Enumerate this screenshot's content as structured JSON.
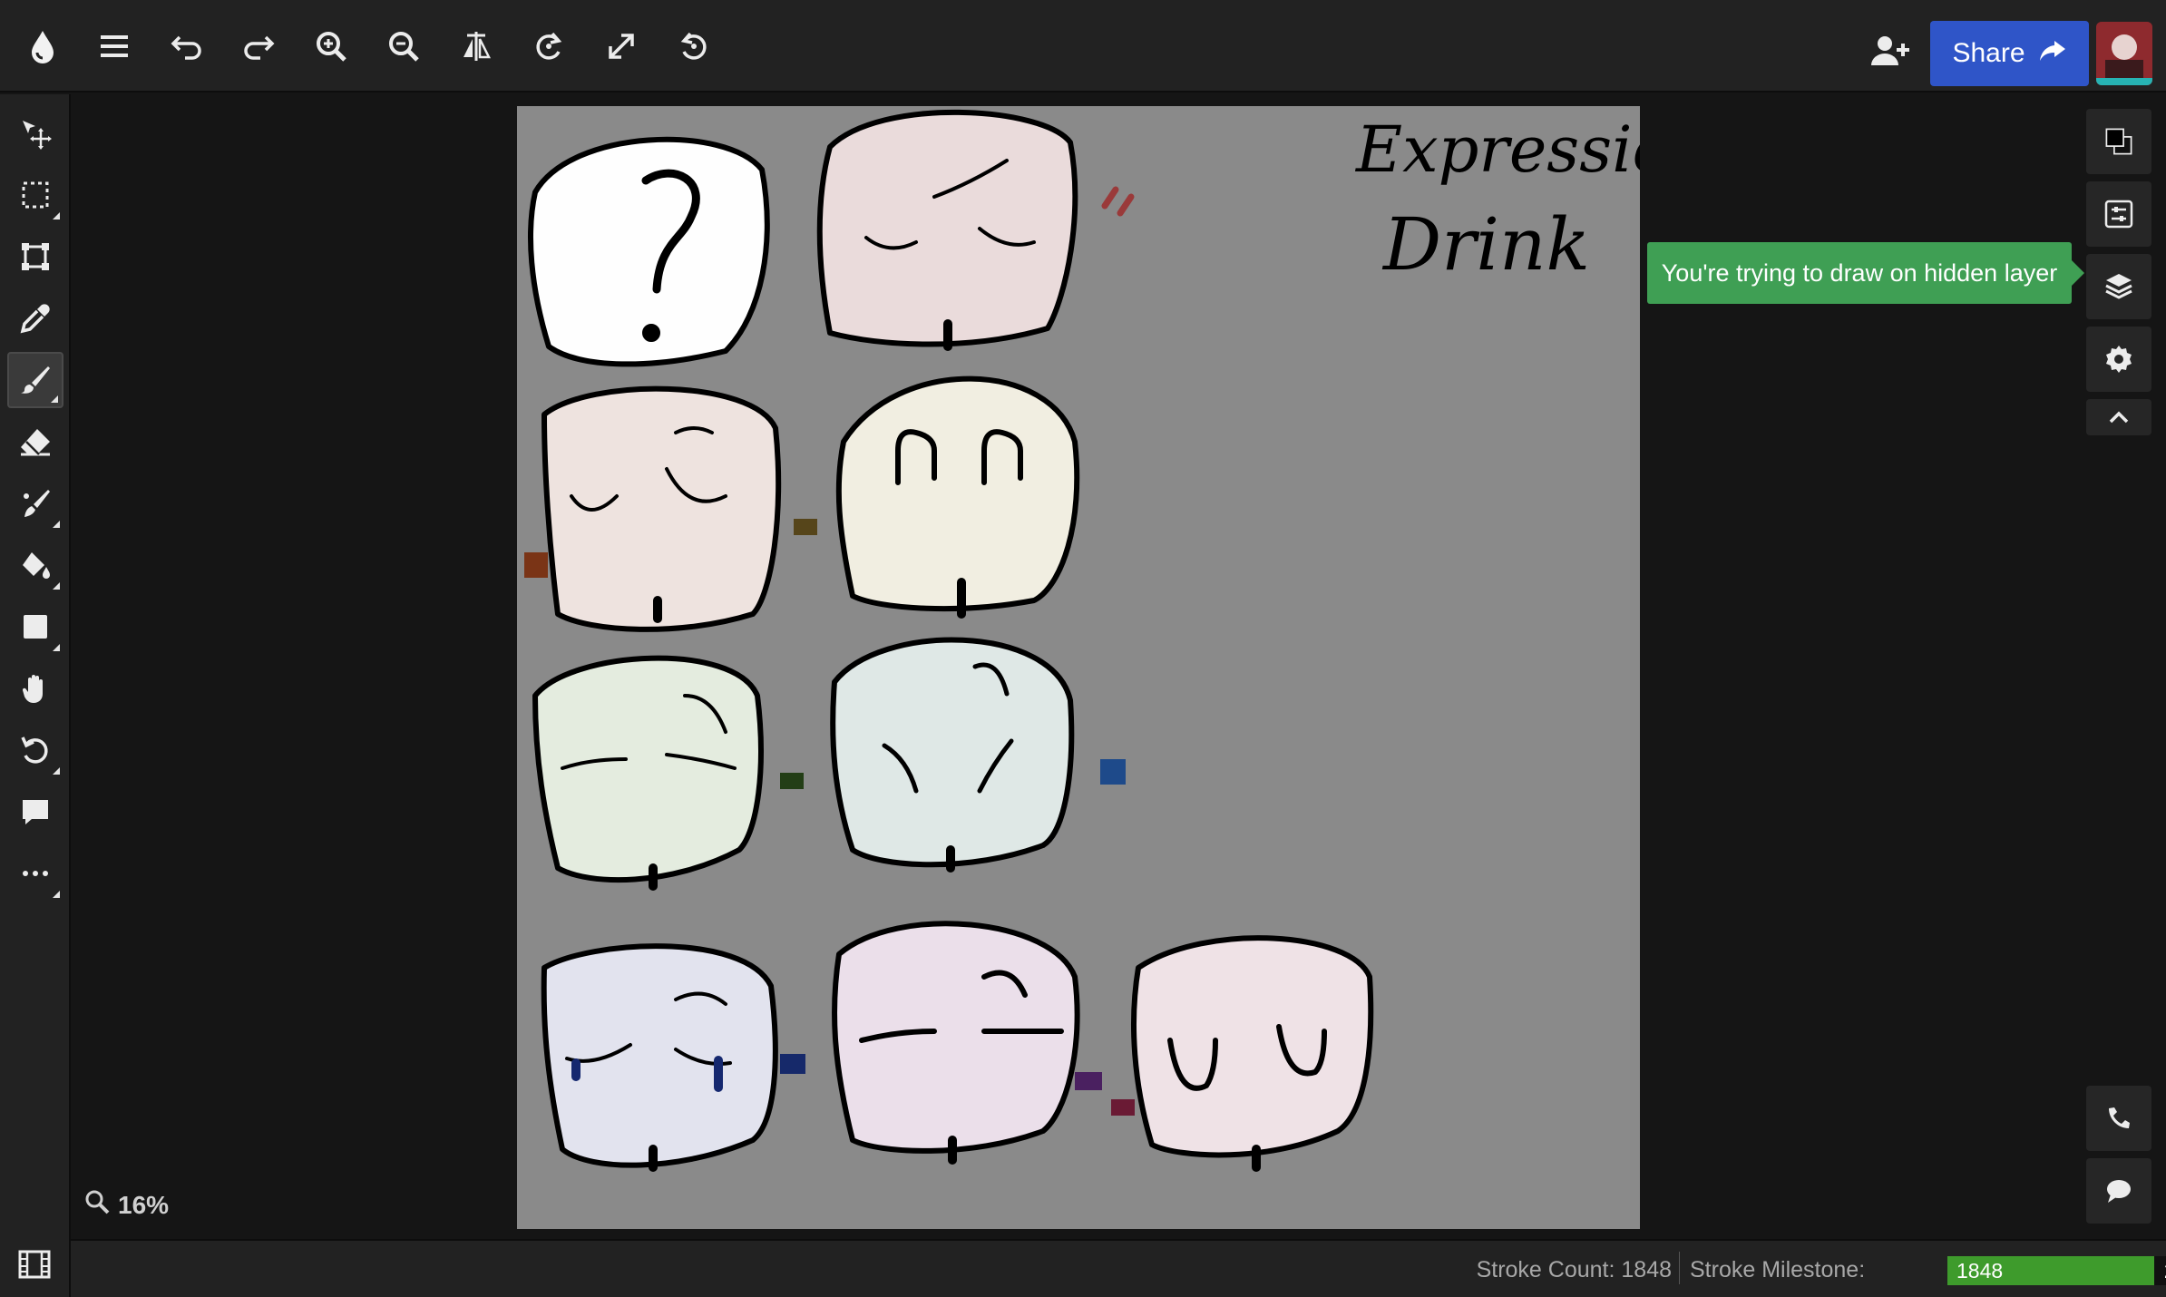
{
  "toolbar": {
    "icons": [
      "logo-drop-icon",
      "menu-icon",
      "undo-icon",
      "redo-icon",
      "zoom-in-icon",
      "zoom-out-icon",
      "flip-horizontal-icon",
      "rotate-left-icon",
      "fullscreen-icon",
      "rotate-right-icon"
    ],
    "share_label": "Share"
  },
  "tools": [
    "move-icon",
    "rectangle-select-icon",
    "transform-icon",
    "eyedropper-icon",
    "brush-icon",
    "eraser-icon",
    "smudge-icon",
    "fill-bucket-icon",
    "shape-icon",
    "hand-icon",
    "rotate-view-icon",
    "comment-icon",
    "more-icon"
  ],
  "active_tool": "brush-icon",
  "canvas": {
    "title_line1": "Expressions",
    "title_line2": "Drink",
    "background": "#8a8a8a"
  },
  "right_panel": {
    "icons": [
      "color-swatch-icon",
      "adjustments-icon",
      "layers-icon",
      "settings-icon",
      "collapse-icon",
      "call-icon",
      "chat-icon"
    ]
  },
  "tooltip": {
    "text": "You're trying to draw on hidden layer",
    "color": "#3f9f54"
  },
  "zoom": {
    "label": "16%"
  },
  "status": {
    "stroke_count": "Stroke Count: 1848",
    "milestone_label": "Stroke Milestone:",
    "milestone_current": "1848",
    "milestone_max": "2400",
    "milestone_fraction": 0.77
  },
  "colors": {
    "accent": "#2f55c8",
    "progress": "#3e9b2c"
  }
}
